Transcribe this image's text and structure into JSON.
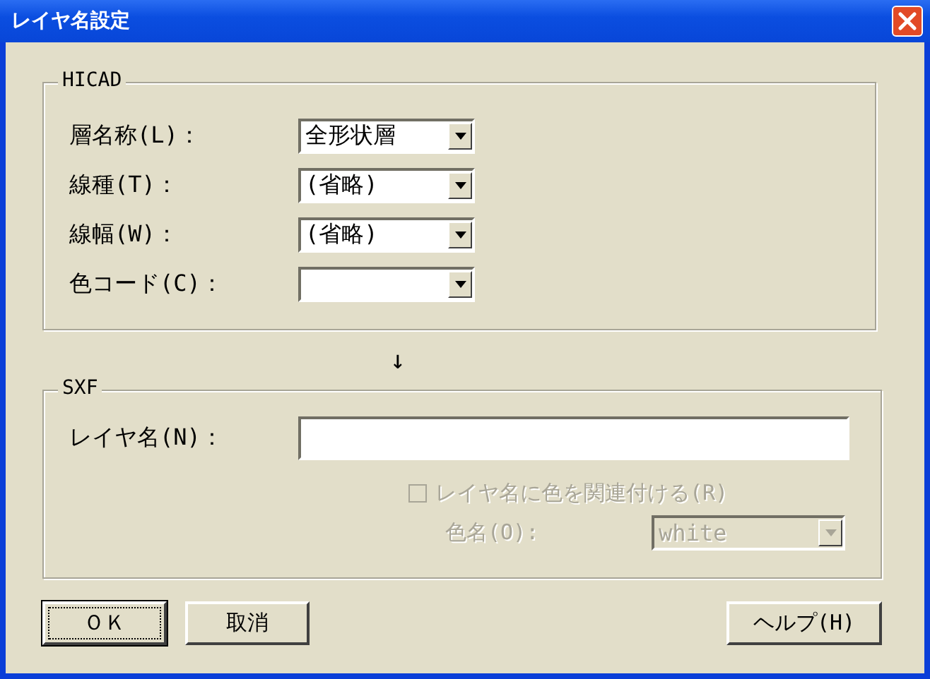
{
  "window": {
    "title": "レイヤ名設定"
  },
  "hicad": {
    "title": "HICAD",
    "fields": [
      {
        "label": "層名称(L)：",
        "value": "全形状層"
      },
      {
        "label": "線種(T)：",
        "value": "(省略)"
      },
      {
        "label": "線幅(W)：",
        "value": "(省略)"
      },
      {
        "label": "色コード(C)："
      }
    ]
  },
  "arrow": "↓",
  "sxf": {
    "title": "SXF",
    "layer_name": {
      "label": "レイヤ名(N)："
    },
    "color_link": {
      "label": "レイヤ名に色を関連付ける(R)",
      "checked": false,
      "disabled": true
    },
    "color_name": {
      "label": "色名(O):",
      "value": "white",
      "disabled": true
    }
  },
  "buttons": [
    {
      "label": "ＯＫ",
      "default": true
    },
    {
      "label": "取消",
      "default": false
    },
    {
      "label": "ヘルプ(H)",
      "default": false
    }
  ]
}
